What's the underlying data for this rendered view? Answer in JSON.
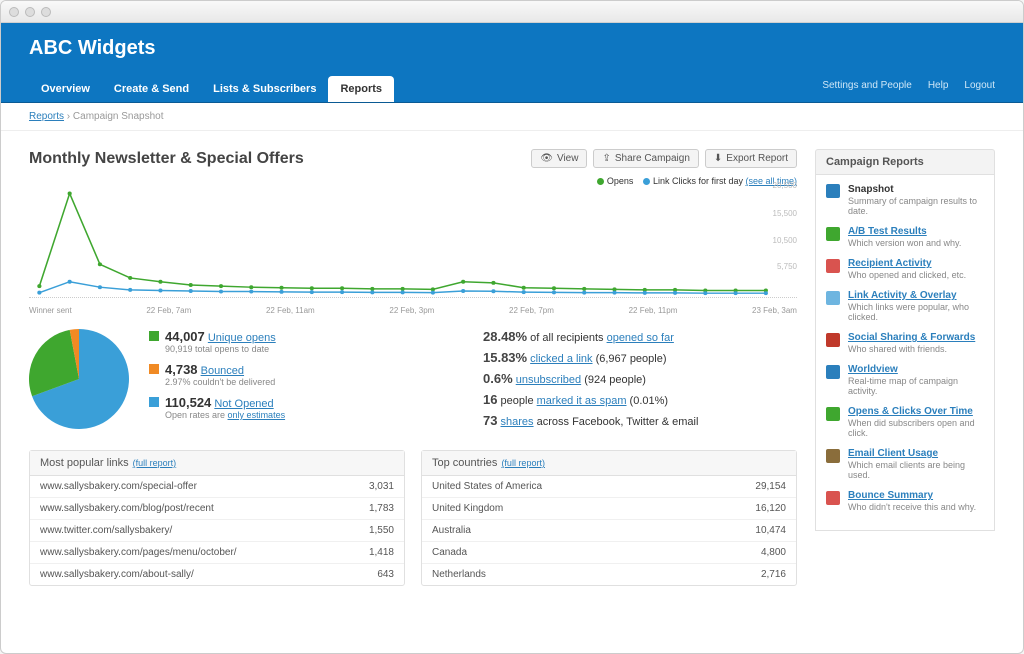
{
  "brand": "ABC Widgets",
  "nav": {
    "items": [
      "Overview",
      "Create & Send",
      "Lists & Subscribers",
      "Reports"
    ],
    "active": 3,
    "right": [
      "Settings and People",
      "Help",
      "Logout"
    ]
  },
  "breadcrumb": {
    "root": "Reports",
    "current": "Campaign Snapshot"
  },
  "page_title": "Monthly Newsletter & Special Offers",
  "buttons": {
    "view": "View",
    "share": "Share Campaign",
    "export": "Export Report"
  },
  "legend": {
    "opens": "Opens",
    "clicks": "Link Clicks for first day",
    "see_all": "(see all time)"
  },
  "chart_data": {
    "type": "line",
    "ylim": [
      0,
      20000
    ],
    "yticks": [
      5750,
      10500,
      15500,
      20500
    ],
    "categories": [
      "Winner sent",
      "22 Feb, 7am",
      "22 Feb, 11am",
      "22 Feb, 3pm",
      "22 Feb, 7pm",
      "22 Feb, 11pm",
      "23 Feb, 3am"
    ],
    "series": [
      {
        "name": "Opens",
        "color": "#3fa72f",
        "values": [
          2000,
          19000,
          6000,
          3500,
          2800,
          2200,
          2000,
          1800,
          1700,
          1600,
          1600,
          1500,
          1500,
          1400,
          2800,
          2600,
          1700,
          1600,
          1500,
          1400,
          1300,
          1300,
          1200,
          1200,
          1200
        ]
      },
      {
        "name": "Link Clicks",
        "color": "#3a9fd8",
        "values": [
          800,
          2800,
          1800,
          1300,
          1200,
          1100,
          1000,
          1000,
          950,
          900,
          900,
          850,
          850,
          800,
          1100,
          1050,
          900,
          850,
          800,
          800,
          750,
          750,
          700,
          700,
          700
        ]
      }
    ]
  },
  "pie": {
    "opened": 44007,
    "bounced": 4738,
    "not_opened": 110524,
    "colors": {
      "opened": "#3fa72f",
      "bounced": "#f08a24",
      "not_opened": "#3a9fd8"
    }
  },
  "stats": {
    "unique_opens": {
      "value": "44,007",
      "label": "Unique opens",
      "sub": "90,919 total opens to date"
    },
    "bounced": {
      "value": "4,738",
      "label": "Bounced",
      "sub": "2.97% couldn't be delivered"
    },
    "not_opened": {
      "value": "110,524",
      "label": "Not Opened",
      "sub_prefix": "Open rates are ",
      "sub_link": "only estimates"
    }
  },
  "perf": [
    {
      "pct": "28.48%",
      "text1": "of all recipients ",
      "link": "opened so far"
    },
    {
      "pct": "15.83%",
      "link": "clicked a link",
      "text2": " (6,967 people)"
    },
    {
      "pct": "0.6%",
      "link": "unsubscribed",
      "text2": " (924 people)"
    },
    {
      "pct": "16",
      "text1": "people ",
      "link": "marked it as spam",
      "text2": " (0.01%)"
    },
    {
      "pct": "73",
      "link": "shares",
      "text2": " across Facebook, Twitter & email"
    }
  ],
  "popular_links": {
    "title": "Most popular links",
    "full": "(full report)",
    "rows": [
      {
        "url": "www.sallysbakery.com/special-offer",
        "count": "3,031"
      },
      {
        "url": "www.sallysbakery.com/blog/post/recent",
        "count": "1,783"
      },
      {
        "url": "www.twitter.com/sallysbakery/",
        "count": "1,550"
      },
      {
        "url": "www.sallysbakery.com/pages/menu/october/",
        "count": "1,418"
      },
      {
        "url": "www.sallysbakery.com/about-sally/",
        "count": "643"
      }
    ]
  },
  "countries": {
    "title": "Top countries",
    "full": "(full report)",
    "rows": [
      {
        "name": "United States of America",
        "count": "29,154"
      },
      {
        "name": "United Kingdom",
        "count": "16,120"
      },
      {
        "name": "Australia",
        "count": "10,474"
      },
      {
        "name": "Canada",
        "count": "4,800"
      },
      {
        "name": "Netherlands",
        "count": "2,716"
      }
    ]
  },
  "sidebar": {
    "title": "Campaign Reports",
    "items": [
      {
        "label": "Snapshot",
        "desc": "Summary of campaign results to date.",
        "color": "#2b7fbc",
        "plain": true
      },
      {
        "label": "A/B Test Results",
        "desc": "Which version won and why.",
        "color": "#3fa72f"
      },
      {
        "label": "Recipient Activity",
        "desc": "Who opened and clicked, etc.",
        "color": "#d9534f"
      },
      {
        "label": "Link Activity & Overlay",
        "desc": "Which links were popular, who clicked.",
        "color": "#6eb5e0"
      },
      {
        "label": "Social Sharing & Forwards",
        "desc": "Who shared with friends.",
        "color": "#c0392b"
      },
      {
        "label": "Worldview",
        "desc": "Real-time map of campaign activity.",
        "color": "#2b7fbc"
      },
      {
        "label": "Opens & Clicks Over Time",
        "desc": "When did subscribers open and click.",
        "color": "#3fa72f"
      },
      {
        "label": "Email Client Usage",
        "desc": "Which email clients are being used.",
        "color": "#8a6d3b"
      },
      {
        "label": "Bounce Summary",
        "desc": "Who didn't receive this and why.",
        "color": "#d9534f"
      }
    ]
  }
}
